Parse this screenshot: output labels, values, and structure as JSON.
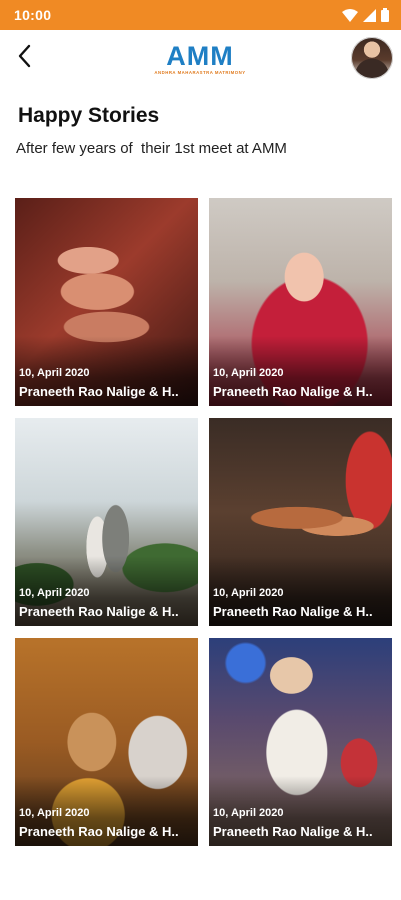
{
  "status_bar": {
    "time": "10:00",
    "background_color": "#f08a24",
    "icons": [
      "wifi-icon",
      "signal-icon",
      "battery-icon"
    ]
  },
  "header": {
    "back_icon": "chevron-left-icon",
    "logo": {
      "text": "AMM",
      "tagline": "ANDHRA MAHARASTRA MATRIMONY",
      "brand_color": "#1f7fc4",
      "accent_color": "#e07b1f"
    },
    "avatar_icon": "user-avatar"
  },
  "page": {
    "title": "Happy Stories",
    "subtitle": "After few years of  their 1st meet at AMM"
  },
  "stories": [
    {
      "date": "10, April 2020",
      "names": "Praneeth Rao Nalige & H.."
    },
    {
      "date": "10, April 2020",
      "names": "Praneeth Rao Nalige & H.."
    },
    {
      "date": "10, April 2020",
      "names": "Praneeth Rao Nalige & H.."
    },
    {
      "date": "10, April 2020",
      "names": "Praneeth Rao Nalige & H.."
    },
    {
      "date": "10, April 2020",
      "names": "Praneeth Rao Nalige & H.."
    },
    {
      "date": "10, April 2020",
      "names": "Praneeth Rao Nalige & H.."
    }
  ]
}
